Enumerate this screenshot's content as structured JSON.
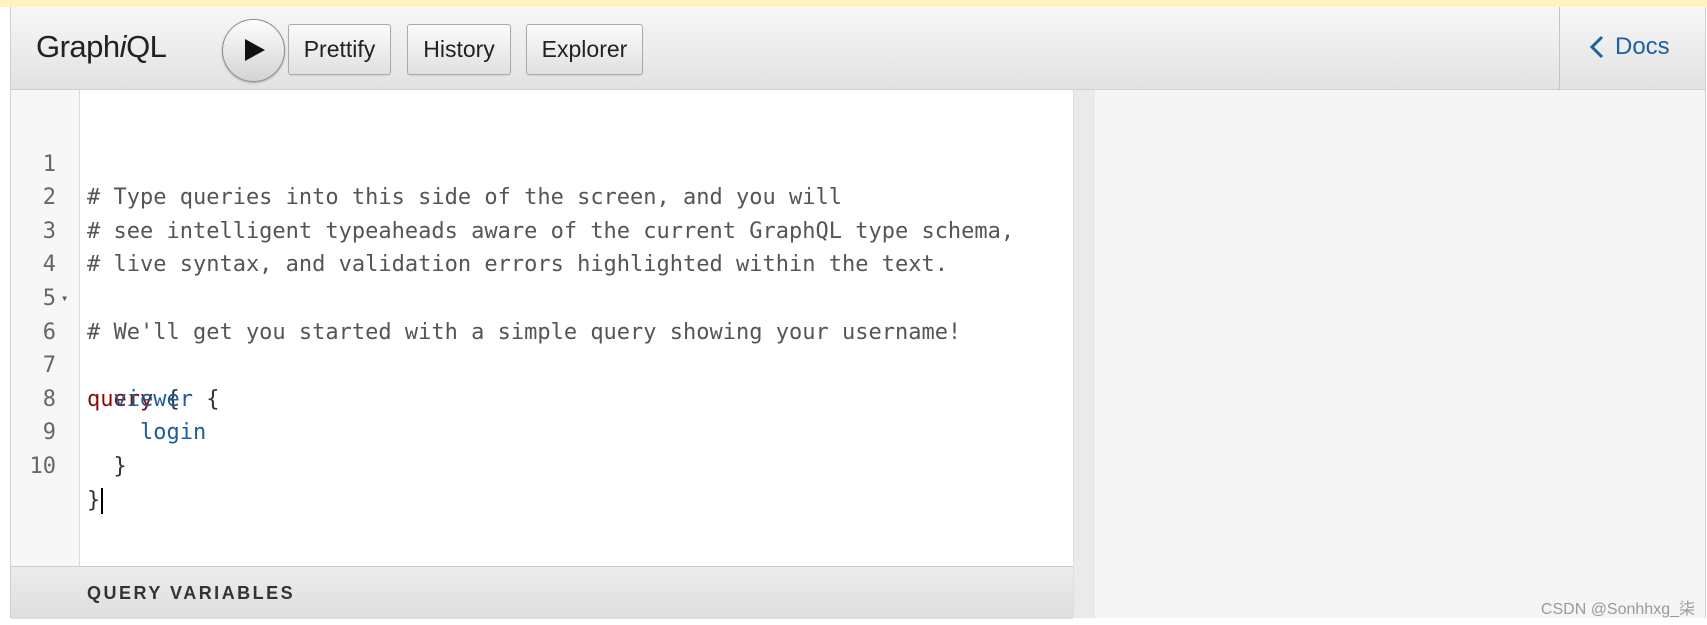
{
  "header": {
    "logo_prefix": "Graph",
    "logo_italic": "i",
    "logo_suffix": "QL",
    "buttons": {
      "prettify": "Prettify",
      "history": "History",
      "explorer": "Explorer"
    },
    "docs_label": "Docs"
  },
  "editor": {
    "lines": [
      {
        "num": "1",
        "text": "# Type queries into this side of the screen, and you will"
      },
      {
        "num": "2",
        "text": "# see intelligent typeaheads aware of the current GraphQL type schema,"
      },
      {
        "num": "3",
        "text": "# live syntax, and validation errors highlighted within the text."
      },
      {
        "num": "4",
        "text": ""
      },
      {
        "num": "5",
        "text": "# We'll get you started with a simple query showing your username!"
      },
      {
        "num": "6",
        "keyword": "query",
        "brace": "{"
      },
      {
        "num": "7",
        "field": "viewer",
        "brace": "{"
      },
      {
        "num": "8",
        "field": "login"
      },
      {
        "num": "9",
        "brace": "}"
      },
      {
        "num": "10",
        "brace": "}"
      }
    ],
    "fold_marker": "▾"
  },
  "variables_panel": {
    "title": "QUERY VARIABLES"
  },
  "footer": {
    "watermark": "CSDN @Sonhhxg_柒"
  },
  "colors": {
    "keyword": "#8a0a0a",
    "field": "#1f5c9a",
    "comment": "#555555",
    "link": "#1f61a0"
  }
}
